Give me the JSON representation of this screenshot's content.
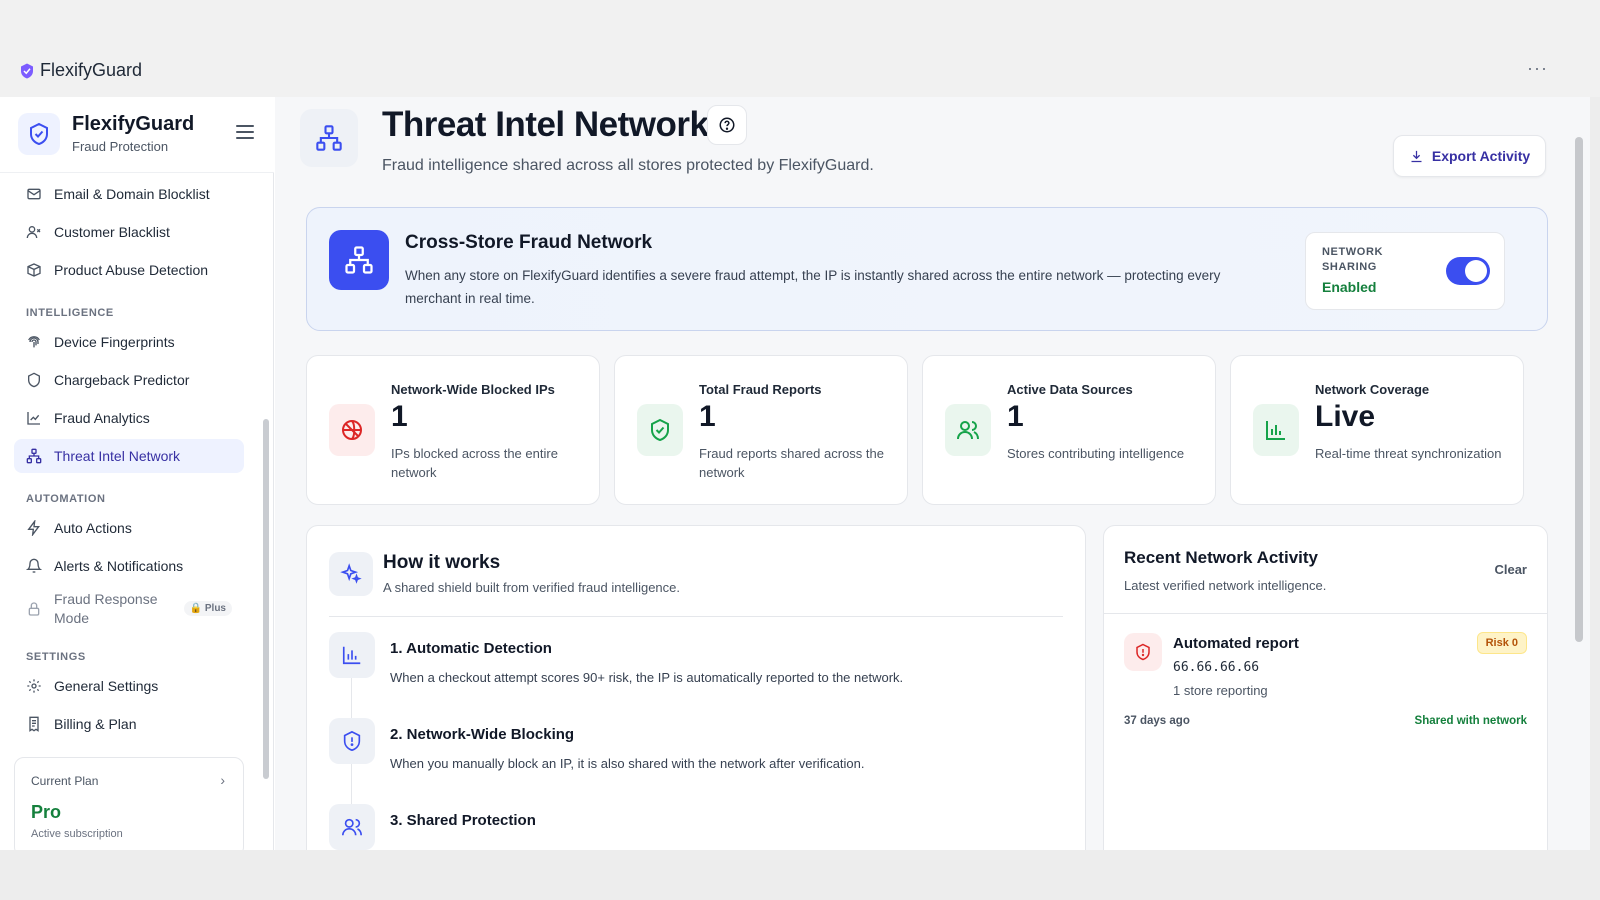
{
  "window": {
    "title": "FlexifyGuard",
    "more": "···"
  },
  "sidebar": {
    "brand": "FlexifyGuard",
    "brand_sub": "Fraud Protection",
    "items_top": [
      {
        "label": "Email & Domain Blocklist",
        "icon": "mail-icon"
      },
      {
        "label": "Customer Blacklist",
        "icon": "user-x-icon"
      },
      {
        "label": "Product Abuse Detection",
        "icon": "package-icon"
      }
    ],
    "sections": {
      "intelligence": "INTELLIGENCE",
      "automation": "AUTOMATION",
      "settings": "SETTINGS"
    },
    "items_intelligence": [
      {
        "label": "Device Fingerprints",
        "icon": "fingerprint-icon"
      },
      {
        "label": "Chargeback Predictor",
        "icon": "shield-icon"
      },
      {
        "label": "Fraud Analytics",
        "icon": "chart-line-icon"
      },
      {
        "label": "Threat Intel Network",
        "icon": "network-icon",
        "active": true
      }
    ],
    "items_automation": [
      {
        "label": "Auto Actions",
        "icon": "bolt-icon"
      },
      {
        "label": "Alerts & Notifications",
        "icon": "bell-icon"
      },
      {
        "label": "Fraud Response Mode",
        "icon": "lock-icon",
        "badge": "Plus"
      }
    ],
    "items_settings": [
      {
        "label": "General Settings",
        "icon": "gear-icon"
      },
      {
        "label": "Billing & Plan",
        "icon": "receipt-icon"
      }
    ],
    "plan": {
      "label": "Current Plan",
      "name": "Pro",
      "sub": "Active subscription"
    }
  },
  "page": {
    "title": "Threat Intel Network",
    "subtitle": "Fraud intelligence shared across all stores protected by FlexifyGuard.",
    "export_label": "Export Activity"
  },
  "banner": {
    "title": "Cross-Store Fraud Network",
    "text": "When any store on FlexifyGuard identifies a severe fraud attempt, the IP is instantly shared across the entire network — protecting every merchant in real time.",
    "sharing_label": "NETWORK SHARING",
    "sharing_state": "Enabled",
    "sharing_on": true
  },
  "stats": [
    {
      "label": "Network-Wide Blocked IPs",
      "value": "1",
      "desc": "IPs blocked across the entire network",
      "icon": "ban-icon",
      "color": "#dc2626",
      "bg": "#fdecec"
    },
    {
      "label": "Total Fraud Reports",
      "value": "1",
      "desc": "Fraud reports shared across the network",
      "icon": "shield-check-icon",
      "color": "#16a34a",
      "bg": "#eaf6ee"
    },
    {
      "label": "Active Data Sources",
      "value": "1",
      "desc": "Stores contributing intelligence",
      "icon": "users-icon",
      "color": "#16a34a",
      "bg": "#eaf6ee"
    },
    {
      "label": "Network Coverage",
      "value": "Live",
      "desc": "Real-time threat synchronization",
      "icon": "bar-chart-icon",
      "color": "#16a34a",
      "bg": "#eaf6ee"
    }
  ],
  "how": {
    "title": "How it works",
    "subtitle": "A shared shield built from verified fraud intelligence.",
    "steps": [
      {
        "title": "1. Automatic Detection",
        "text": "When a checkout attempt scores 90+ risk, the IP is automatically reported to the network.",
        "icon": "bar-chart-icon"
      },
      {
        "title": "2. Network-Wide Blocking",
        "text": "When you manually block an IP, it is also shared with the network after verification.",
        "icon": "shield-alert-icon"
      },
      {
        "title": "3. Shared Protection",
        "text": "",
        "icon": "users-icon"
      }
    ]
  },
  "recent": {
    "title": "Recent Network Activity",
    "subtitle": "Latest verified network intelligence.",
    "clear_label": "Clear",
    "item": {
      "name": "Automated report",
      "ip": "66.66.66.66",
      "stores": "1 store reporting",
      "risk": "Risk 0",
      "time": "37 days ago",
      "shared": "Shared with network"
    }
  }
}
